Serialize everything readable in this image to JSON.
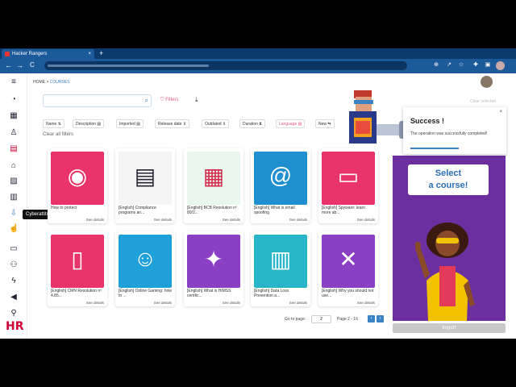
{
  "browser": {
    "tab_title": "Hacker Rangers",
    "tab_close": "×",
    "new_tab": "+",
    "back": "←",
    "forward": "→",
    "reload": "C"
  },
  "nav": {
    "breadcrumb_home": "HOME",
    "breadcrumb_sep": ">",
    "breadcrumb_current": "COURSES",
    "tooltip": "Cyberattitude types",
    "logo": "HR"
  },
  "toolbar": {
    "filters_label": "Filters",
    "clear_selected": "Clear selected",
    "clear_all_filters": "Clear all filters"
  },
  "filter_chips": [
    {
      "label": "Name ⇅"
    },
    {
      "label": "Description ▤"
    },
    {
      "label": "Imported ▤"
    },
    {
      "label": "Release date ⇕"
    },
    {
      "label": "Outdated ⇕"
    },
    {
      "label": "Duration ⧗"
    },
    {
      "label": "Language ▤"
    },
    {
      "label": "New ⇆"
    }
  ],
  "courses": [
    {
      "title": "How to protect",
      "details": "See details",
      "color": "#e8336b",
      "glyph": "◉"
    },
    {
      "title": "[English] Compliance programs an...",
      "details": "See details",
      "color": "#ffffff",
      "glyph": "▤"
    },
    {
      "title": "[English] BCB Resolution nº 80/2...",
      "details": "See details",
      "color": "#ffffff",
      "glyph": "▦"
    },
    {
      "title": "[English] What is email spoofing",
      "details": "See details",
      "color": "#1f8fd0",
      "glyph": "@"
    },
    {
      "title": "[English] Spyware: learn more ab...",
      "details": "See details",
      "color": "#e8336b",
      "glyph": "▭"
    },
    {
      "title": "[English] CMN Resolution nº 4.85...",
      "details": "See details",
      "color": "#e8336b",
      "glyph": "▯"
    },
    {
      "title": "[English] Online Gaming: how to ...",
      "details": "See details",
      "color": "#1fa0d8",
      "glyph": "☺"
    },
    {
      "title": "[English] What is HIMSS certific...",
      "details": "See details",
      "color": "#8a3fc4",
      "glyph": "✦"
    },
    {
      "title": "[English] Data Loss Prevention a...",
      "details": "See details",
      "color": "#27b5c9",
      "glyph": "▥"
    },
    {
      "title": "[English] Why you should not use...",
      "details": "See details",
      "color": "#8a3fc4",
      "glyph": "✕"
    }
  ],
  "pagination": {
    "go_to_label": "Go to page:",
    "page_value": "2",
    "range": "Page 2 - 16",
    "prev": "‹",
    "next": "›"
  },
  "popup": {
    "title": "Success !",
    "message": "The operation was successfully completed!",
    "close": "×"
  },
  "promo": {
    "line1": "Select",
    "line2": "a course!"
  },
  "import_button": "Import",
  "colors": {
    "accent": "#3b82c4",
    "filter_pink": "#e35a8b",
    "promo_purple": "#6b2fa0"
  }
}
